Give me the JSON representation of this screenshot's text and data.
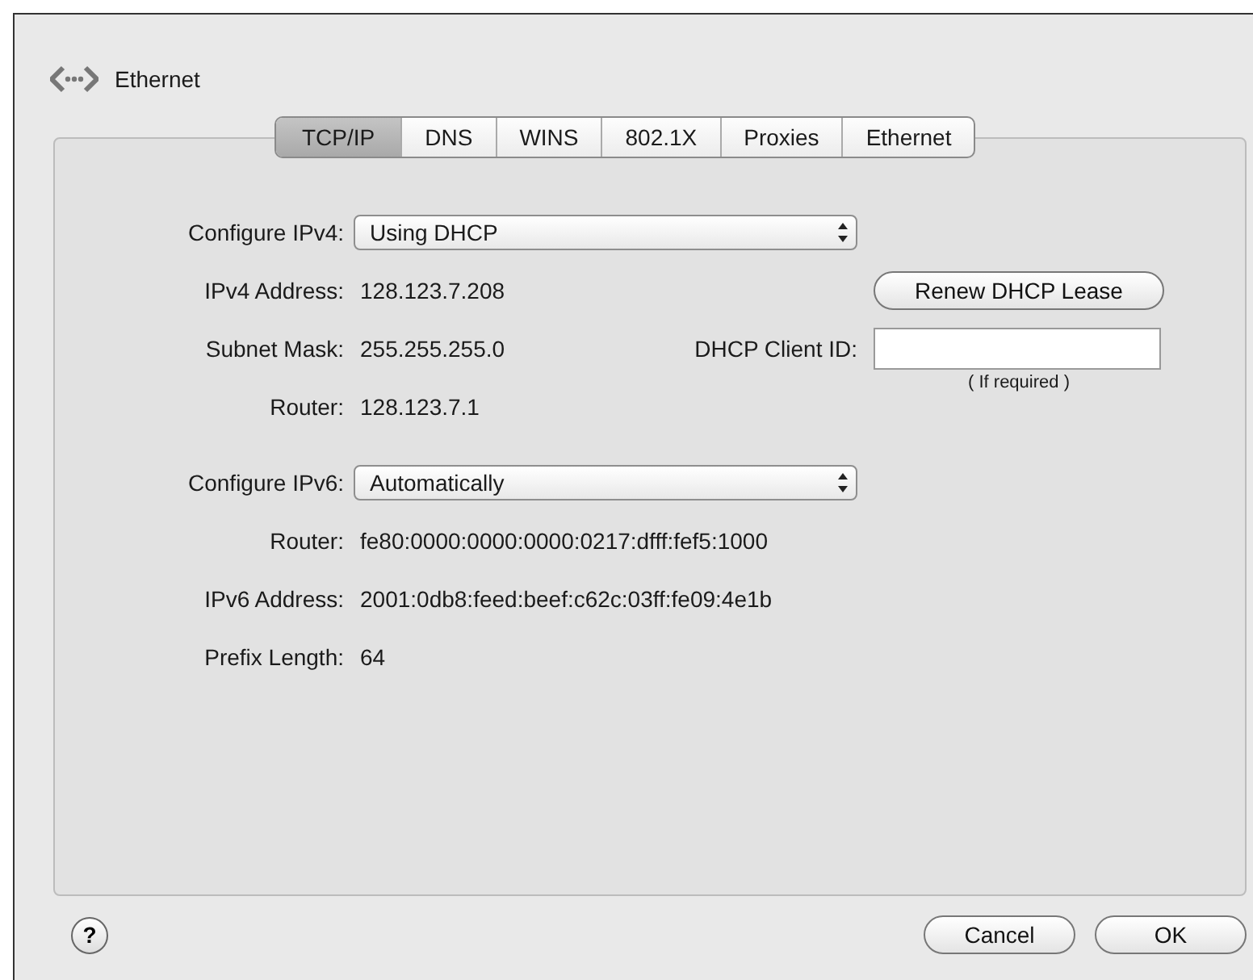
{
  "window": {
    "title": "Ethernet"
  },
  "tabs": [
    {
      "label": "TCP/IP",
      "selected": true
    },
    {
      "label": "DNS",
      "selected": false
    },
    {
      "label": "WINS",
      "selected": false
    },
    {
      "label": "802.1X",
      "selected": false
    },
    {
      "label": "Proxies",
      "selected": false
    },
    {
      "label": "Ethernet",
      "selected": false
    }
  ],
  "ipv4": {
    "configure": {
      "label": "Configure IPv4:",
      "value": "Using DHCP"
    },
    "fields": [
      {
        "label": "IPv4 Address:",
        "value": "128.123.7.208"
      },
      {
        "label": "Subnet Mask:",
        "value": "255.255.255.0"
      },
      {
        "label": "Router:",
        "value": "128.123.7.1"
      }
    ],
    "renew_button": "Renew DHCP Lease",
    "client_id": {
      "label": "DHCP Client ID:",
      "hint": "( If required )"
    }
  },
  "ipv6": {
    "configure": {
      "label": "Configure IPv6:",
      "value": "Automatically"
    },
    "fields": [
      {
        "label": "Router:",
        "value": "fe80:0000:0000:0000:0217:dfff:fef5:1000"
      },
      {
        "label": "IPv6 Address:",
        "value": "2001:0db8:feed:beef:c62c:03ff:fe09:4e1b"
      },
      {
        "label": "Prefix Length:",
        "value": "64"
      }
    ]
  },
  "help_button": "?",
  "buttons": [
    "Cancel",
    "OK"
  ]
}
